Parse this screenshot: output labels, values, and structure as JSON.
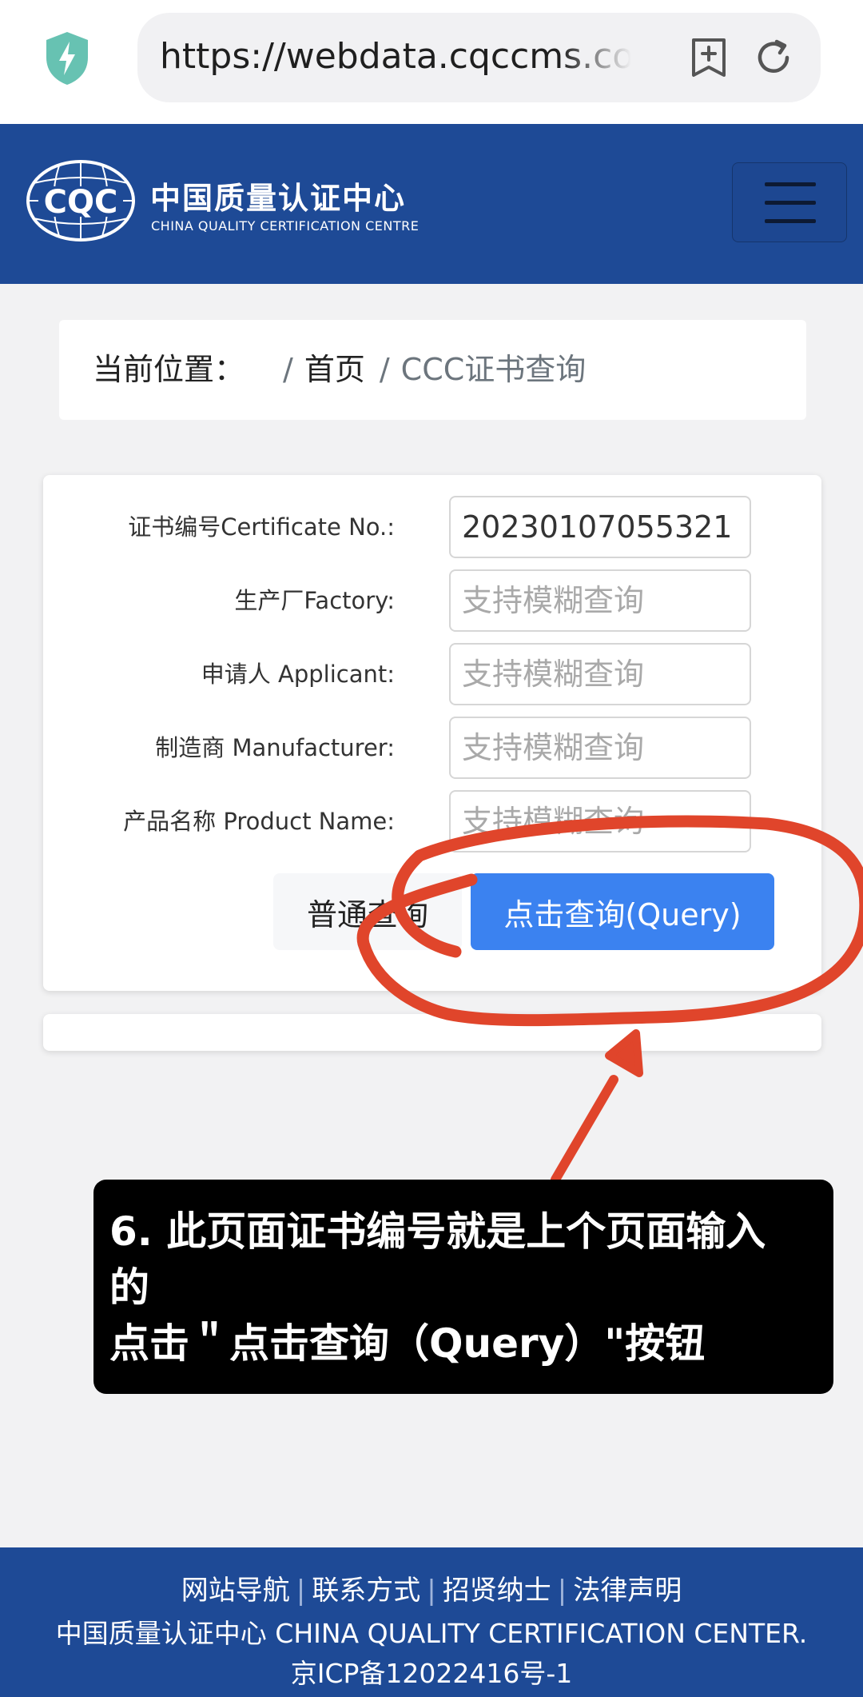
{
  "browser": {
    "url": "https://webdata.cqccms.com.cn"
  },
  "header": {
    "logo_text": "CQC",
    "brand_cn": "中国质量认证中心",
    "brand_en": "CHINA QUALITY CERTIFICATION CENTRE"
  },
  "breadcrumb": {
    "prefix": "当前位置：",
    "separator": "/",
    "home": "首页",
    "current": "CCC证书查询"
  },
  "form": {
    "fields": [
      {
        "label": "证书编号Certificate No.:",
        "value": "20230107055321",
        "placeholder": ""
      },
      {
        "label": "生产厂Factory:",
        "value": "",
        "placeholder": "支持模糊查询"
      },
      {
        "label": "申请人 Applicant:",
        "value": "",
        "placeholder": "支持模糊查询"
      },
      {
        "label": "制造商 Manufacturer:",
        "value": "",
        "placeholder": "支持模糊查询"
      },
      {
        "label": "产品名称 Product Name:",
        "value": "",
        "placeholder": "支持模糊查询"
      }
    ],
    "normal_button": "普通查询",
    "query_button": "点击查询(Query)"
  },
  "annotation": {
    "line1": "6. 此页面证书编号就是上个页面输入",
    "line2": "的",
    "line3": "点击＂点击查询（Query）\"按钮",
    "color": "#e0452b"
  },
  "footer": {
    "links": [
      "网站导航",
      "联系方式",
      "招贤纳士",
      "法律声明"
    ],
    "separator": "|",
    "org": "中国质量认证中心 CHINA QUALITY CERTIFICATION CENTER.",
    "icp": "京ICP备12022416号-1"
  },
  "colors": {
    "header_bg": "#1e4a96",
    "primary_button": "#3b82f0",
    "page_bg": "#f2f2f3"
  }
}
